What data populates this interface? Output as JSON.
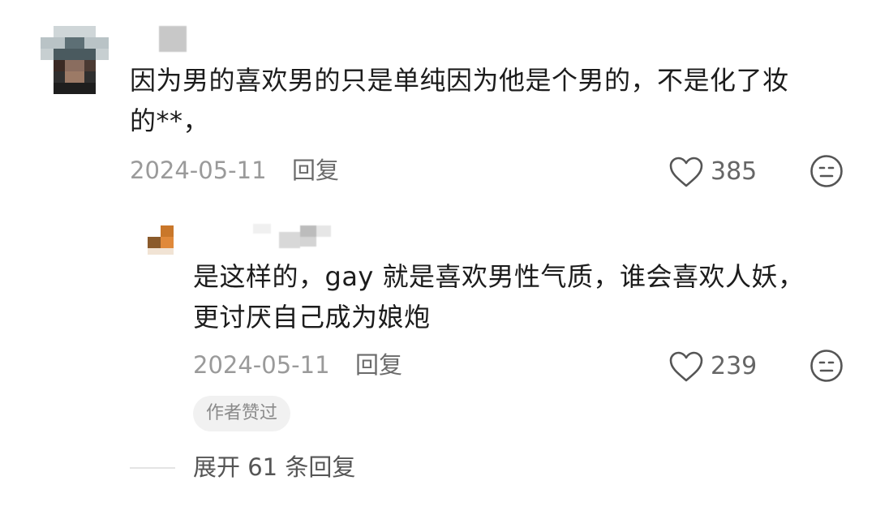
{
  "comment": {
    "text_line1": "因为男的喜欢男的只是单纯因为他是个男的，不是化了妆",
    "text_line2": "的**，",
    "date": "2024-05-11",
    "reply_label": "回复",
    "likes": "385"
  },
  "reply": {
    "text_line1": "是这样的，gay 就是喜欢男性气质，谁会喜欢人妖，",
    "text_line2": "更讨厌自己成为娘炮",
    "date": "2024-05-11",
    "reply_label": "回复",
    "likes": "239",
    "author_badge": "作者赞过"
  },
  "expand_label": "展开 61 条回复",
  "icons": {
    "like": "heart-outline-icon",
    "dislike": "neutral-face-icon"
  },
  "colors": {
    "text": "#1c1c1c",
    "meta": "#9a9a9a",
    "icon": "#555555",
    "badge_bg": "#f1f1f1"
  }
}
